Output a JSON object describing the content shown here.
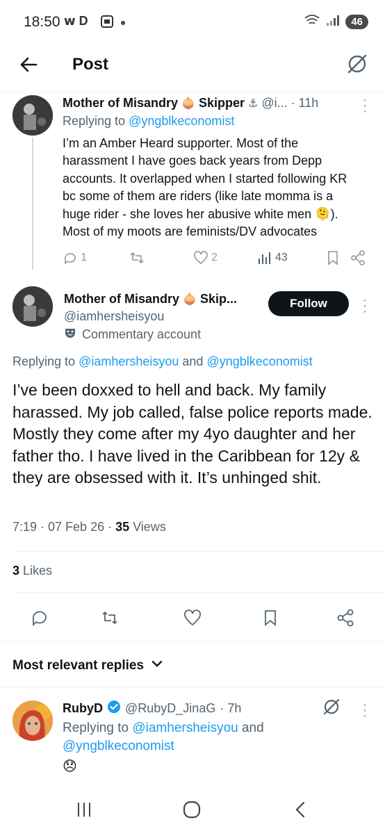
{
  "status_bar": {
    "time": "18:50",
    "left_icons": "𝘄 D",
    "battery": "46"
  },
  "header": {
    "title": "Post"
  },
  "parent_reply": {
    "name": "Mother of Misandry",
    "name_suffix": "Skipper",
    "handle": "@i...",
    "time": "· 11h",
    "replying_prefix": "Replying to ",
    "replying_to": "@yngblkeconomist",
    "text": "I’m an Amber Heard supporter. Most of the harassment I have goes back years from Depp accounts. It overlapped when I started following KR bc some of them are riders (like late momma is a huge rider - she loves her abusive white men 🫠). Most of my moots are feminists/DV advocates",
    "replies": "1",
    "reposts": "",
    "likes": "2",
    "views": "43"
  },
  "main_post": {
    "name": "Mother of Misandry",
    "name_suffix": "Skip...",
    "handle": "@iamhersheisyou",
    "follow_label": "Follow",
    "account_label": "Commentary account",
    "replying_prefix": "Replying to ",
    "replying_to_1": "@iamhersheisyou",
    "replying_and": " and ",
    "replying_to_2": "@yngblkeconomist",
    "text": "I’ve been doxxed to hell and back. My family harassed. My job called, false police reports made. Mostly they come after my 4yo daughter and her father tho. I have lived in the Caribbean for 12y & they are obsessed with it. It’s unhinged shit.",
    "time": "7:19 · 07 Feb 26 · ",
    "views_count": "35",
    "views_label": " Views",
    "likes_count": "3",
    "likes_label": " Likes"
  },
  "replies_section": {
    "sort_label": "Most relevant replies"
  },
  "reply": {
    "name": "RubyD",
    "handle": "@RubyD_JinaG",
    "time": "· 7h",
    "replying_prefix": "Replying to ",
    "replying_to_1": "@iamhersheisyou",
    "replying_and": " and",
    "replying_to_2": "@yngblkeconomist",
    "text": "😞"
  },
  "colors": {
    "accent": "#1d9bf0",
    "text": "#0f1419",
    "muted": "#536471"
  }
}
